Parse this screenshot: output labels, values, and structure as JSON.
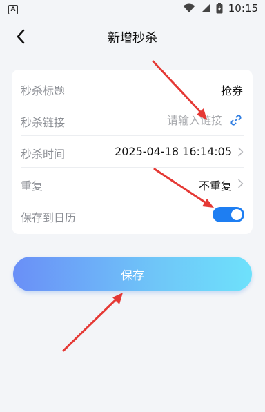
{
  "status_bar": {
    "time": "10:15",
    "app_badge": "A"
  },
  "header": {
    "title": "新增秒杀"
  },
  "form": {
    "title_row": {
      "label": "秒杀标题",
      "value": "抢券"
    },
    "link_row": {
      "label": "秒杀链接",
      "placeholder": "请输入链接"
    },
    "time_row": {
      "label": "秒杀时间",
      "value": "2025-04-18 16:14:05"
    },
    "repeat_row": {
      "label": "重复",
      "value": "不重复"
    },
    "calendar_row": {
      "label": "保存到日历",
      "enabled": true
    }
  },
  "save_button": {
    "label": "保存"
  },
  "colors": {
    "accent": "#1e7ef2",
    "gradient_start": "#6a8ff7",
    "gradient_end": "#6ee1fb",
    "annotation_arrow": "#e53935"
  }
}
